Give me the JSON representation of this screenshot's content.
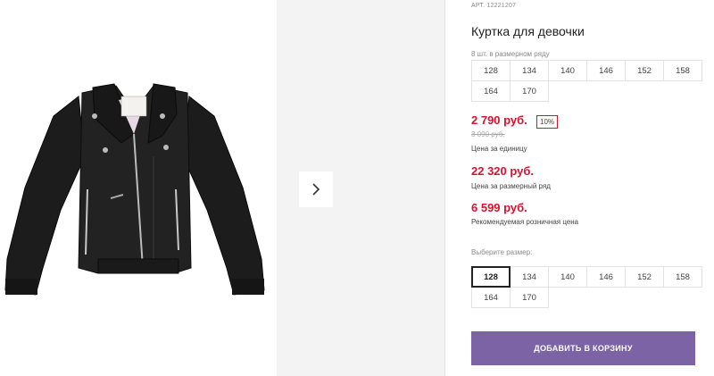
{
  "product": {
    "article": "АРТ. 12221207",
    "title": "Куртка для девочки",
    "image_alt": "Черная куртка-косуха"
  },
  "pack": {
    "label": "8 шт. в размерном ряду",
    "sizes": [
      "128",
      "134",
      "140",
      "146",
      "152",
      "158",
      "164",
      "170"
    ]
  },
  "prices": {
    "unit_price": "2 790 руб.",
    "discount": "10%",
    "old_price": "3 090 руб.",
    "unit_caption": "Цена за единицу",
    "row_price": "22 320 руб.",
    "row_caption": "Цена за размерный ряд",
    "rrp_price": "6 599 руб.",
    "rrp_caption": "Рекомендуемая розничная цена"
  },
  "size_select": {
    "label": "Выберите размер:",
    "options": [
      "128",
      "134",
      "140",
      "146",
      "152",
      "158",
      "164",
      "170"
    ],
    "selected": "128"
  },
  "cart_button": {
    "label": "ДОБАВИТЬ В КОРЗИНУ"
  },
  "colors": {
    "price_red": "#d6122e",
    "button_purple": "#7b63a6",
    "gallery_bg": "#f3f3f3"
  }
}
